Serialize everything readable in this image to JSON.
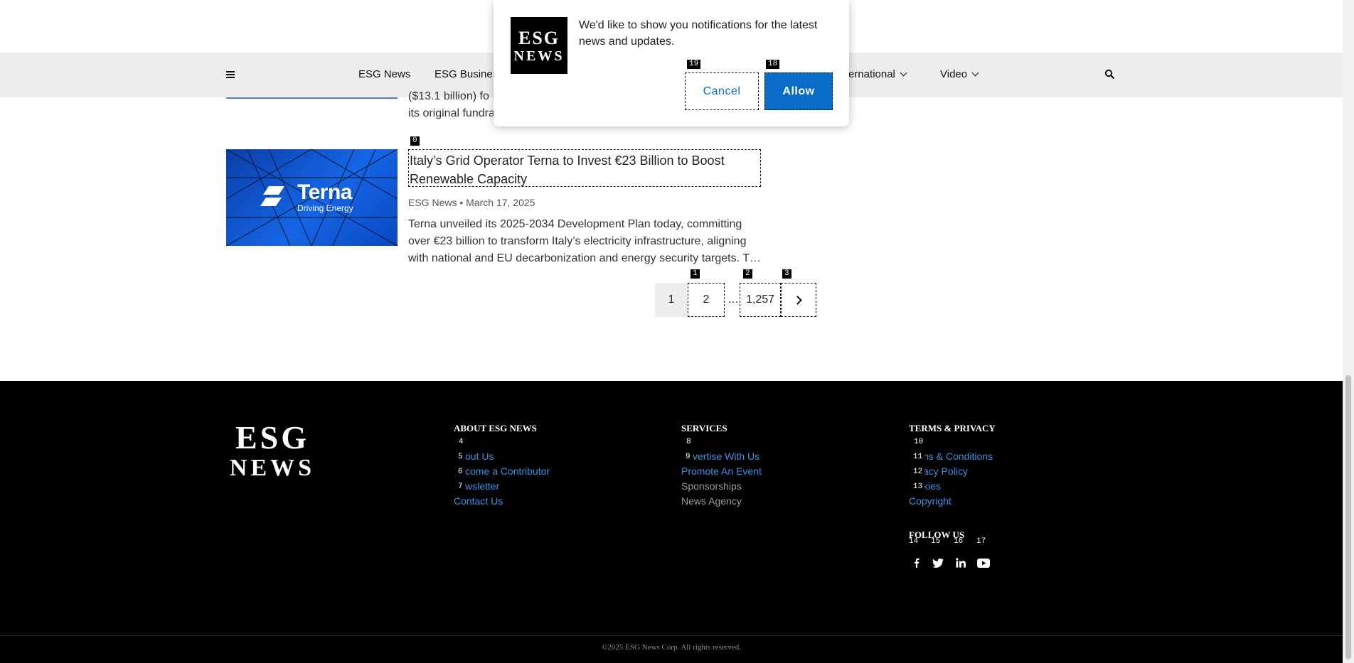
{
  "nav": {
    "items": [
      {
        "label": "ESG News",
        "has_dropdown": false
      },
      {
        "label": "ESG Business",
        "has_dropdown": false
      },
      {
        "label": "International",
        "has_dropdown": true
      },
      {
        "label": "Video",
        "has_dropdown": true
      }
    ],
    "visible_fragment_international": "ernational",
    "icons": [
      "menu-icon",
      "search-icon"
    ]
  },
  "articles": {
    "previous": {
      "line1_fragment": "($13.1 billion) fo",
      "line2_fragment": "its original fundra"
    },
    "terna": {
      "image_brand": "Terna",
      "image_tagline": "Driving Energy",
      "title": "Italy’s Grid Operator Terna to Invest €23 Billion to Boost Renewable Capacity",
      "source": "ESG News",
      "separator": "•",
      "date": "March 17, 2025",
      "excerpt": "Terna unveiled its 2025-2034 Development Plan today, committing over €23 billion to transform Italy’s electricity infrastructure, aligning with national and EU decarbonization and energy security targets. T…"
    }
  },
  "pagination": {
    "current": "1",
    "page2": "2",
    "dots": "…",
    "last": "1,257",
    "next_icon": "chevron-right-icon"
  },
  "footer": {
    "logo_line1": "ESG",
    "logo_line2": "NEWS",
    "about": {
      "heading": "ABOUT ESG NEWS",
      "links": [
        "out Us",
        "come a Contributor",
        "wsletter",
        "Contact Us"
      ]
    },
    "services": {
      "heading": "SERVICES",
      "links": [
        "vertise With Us",
        "Promote An Event",
        "Sponsorships",
        "News Agency"
      ]
    },
    "terms": {
      "heading": "TERMS & PRIVACY",
      "links": [
        "ns & Conditions",
        "acy Policy",
        "kies",
        "Copyright"
      ]
    },
    "follow_heading": "FOLLOW US",
    "social_icons": [
      "facebook-icon",
      "twitter-icon",
      "linkedin-icon",
      "youtube-icon"
    ],
    "copyright": "©2025 ESG News Corp. All rights reserved."
  },
  "notification": {
    "logo_line1": "ESG",
    "logo_line2": "NEWS",
    "message": "We'd like to show you notifications for the latest news and updates.",
    "cancel_label": "Cancel",
    "allow_label": "Allow"
  },
  "markers": [
    "0",
    "1",
    "2",
    "3",
    "4",
    "5",
    "6",
    "7",
    "8",
    "9",
    "10",
    "11",
    "12",
    "13",
    "14",
    "15",
    "16",
    "17",
    "18",
    "19"
  ],
  "colors": {
    "accent": "#0a6cc9",
    "footer_link": "#3b8fe0",
    "footer_bg": "#000000",
    "nav_bg": "#eeeeee"
  }
}
